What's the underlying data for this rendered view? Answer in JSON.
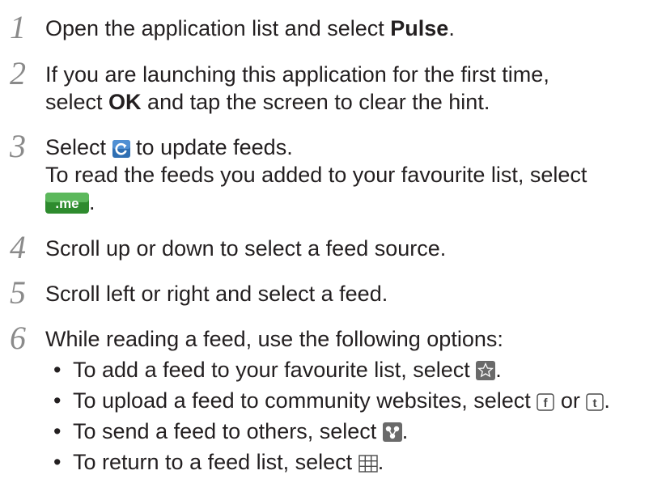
{
  "steps": [
    {
      "number": "1",
      "lines": [
        {
          "pre": "Open the application list and select ",
          "bold": "Pulse",
          "post": "."
        }
      ]
    },
    {
      "number": "2",
      "lines": [
        {
          "text": "If you are launching this application for the first time,"
        },
        {
          "pre": "select ",
          "bold": "OK",
          "post": " and tap the screen to clear the hint."
        }
      ]
    },
    {
      "number": "3",
      "lines": [
        {
          "pre": "Select ",
          "icon": "refresh-icon",
          "post": " to update feeds."
        },
        {
          "text": "To read the feeds you added to your favourite list, select"
        },
        {
          "icon": "me-icon",
          "icon_text": ".me",
          "post": "."
        }
      ]
    },
    {
      "number": "4",
      "lines": [
        {
          "text": "Scroll up or down to select a feed source."
        }
      ]
    },
    {
      "number": "5",
      "lines": [
        {
          "text": "Scroll left or right and select a feed."
        }
      ]
    },
    {
      "number": "6",
      "lines": [
        {
          "text": "While reading a feed, use the following options:"
        }
      ],
      "bullets": [
        {
          "pre": "To add a feed to your favourite list, select ",
          "icon": "star-icon",
          "post": "."
        },
        {
          "pre": "To upload a feed to community websites, select ",
          "icon": "facebook-icon",
          "icon_text": "f",
          "mid": " or ",
          "icon2": "twitter-icon",
          "icon2_text": "t",
          "post": "."
        },
        {
          "pre": "To send a feed to others, select ",
          "icon": "share-icon",
          "post": "."
        },
        {
          "pre": "To return to a feed list, select ",
          "icon": "grid-icon",
          "post": "."
        }
      ]
    }
  ],
  "colors": {
    "text": "#231f20",
    "step_number": "#8a8a8a",
    "refresh_icon_bg": "#2f6fb3",
    "me_icon_bg": "#3a9a3a"
  }
}
